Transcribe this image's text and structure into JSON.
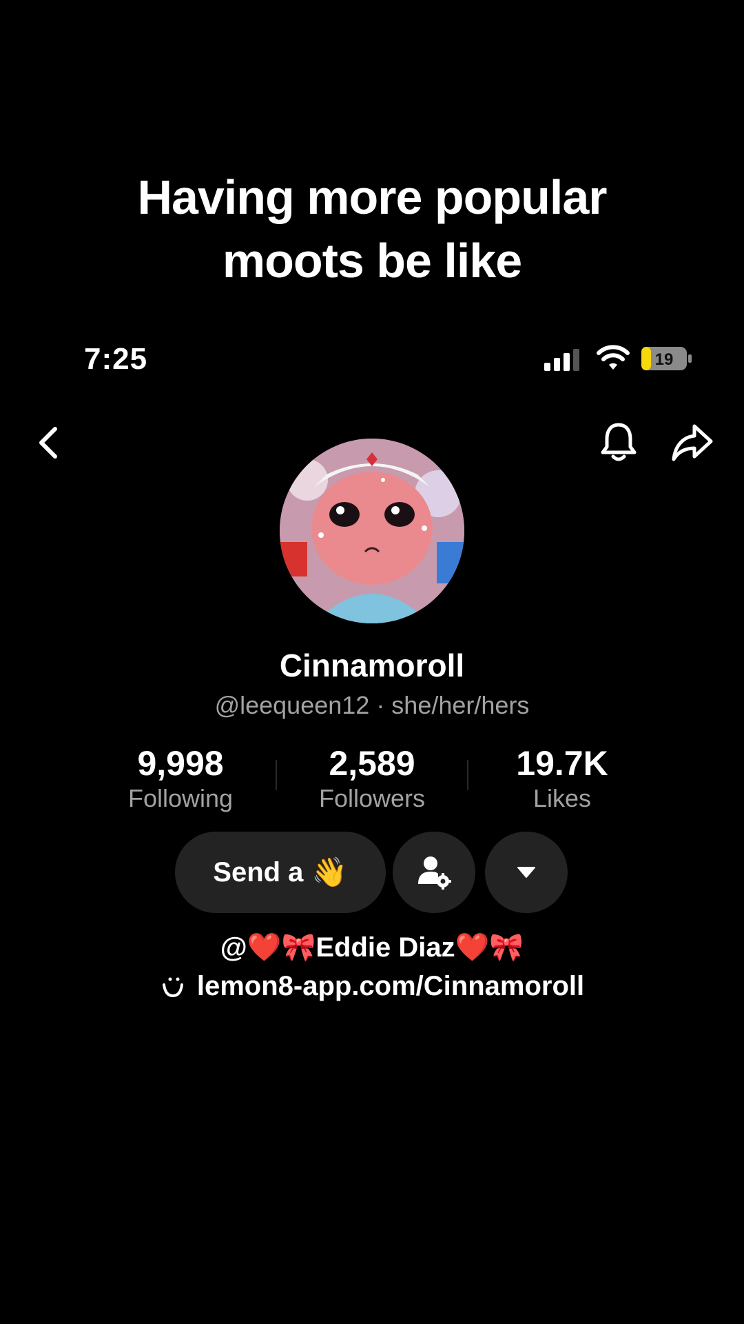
{
  "caption": {
    "line1": "Having more popular",
    "line2": "moots be like"
  },
  "status_bar": {
    "time": "7:25",
    "battery": "19",
    "battery_color": "#f5d90a"
  },
  "profile": {
    "display_name": "Cinnamoroll",
    "handle": "@leequeen12 · she/her/hers",
    "stats": [
      {
        "value": "9,998",
        "label": "Following"
      },
      {
        "value": "2,589",
        "label": "Followers"
      },
      {
        "value": "19.7K",
        "label": "Likes"
      }
    ],
    "bio": "@❤️🎀Eddie Diaz❤️🎀",
    "link": "lemon8-app.com/Cinnamoroll"
  },
  "actions": {
    "send_label": "Send a",
    "send_emoji": "👋"
  },
  "icons": {
    "back": "chevron-left-icon",
    "bell": "bell-icon",
    "share": "share-arrow-icon",
    "user_settings": "user-settings-icon",
    "dropdown": "caret-down-icon",
    "link": "lemon8-smile-icon"
  }
}
